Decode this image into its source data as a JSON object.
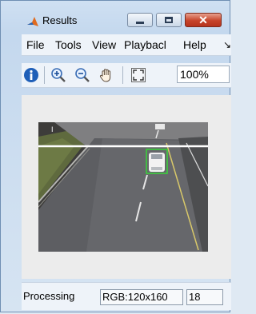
{
  "window": {
    "title": "Results"
  },
  "titlebar_icons": {
    "app": "matlab-logo-icon",
    "minimize": "minimize-icon",
    "maximize": "maximize-icon",
    "close": "close-icon"
  },
  "menu": {
    "items": [
      "File",
      "Tools",
      "View",
      "Playbacl",
      "Help"
    ],
    "overflow_icon": "chevron-double-icon"
  },
  "toolbar": {
    "icons": [
      "info-icon",
      "zoom-in-icon",
      "zoom-out-icon",
      "pan-hand-icon",
      "fit-to-window-icon"
    ],
    "zoom_value": "100%"
  },
  "status": {
    "text": "Processing",
    "format": "RGB:120x160",
    "frame": "18"
  },
  "colors": {
    "detection_box": "#39d63a",
    "close_button": "#c7442a"
  }
}
